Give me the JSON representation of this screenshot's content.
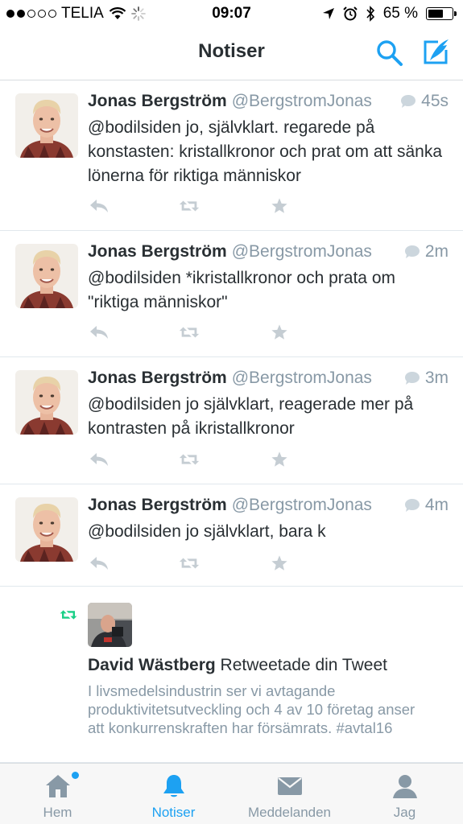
{
  "status_bar": {
    "carrier": "TELIA",
    "time": "09:07",
    "battery_percent": "65 %",
    "battery_level": 0.65,
    "signal_bars": 2
  },
  "header": {
    "title": "Notiser",
    "icons": [
      "search-icon",
      "compose-icon"
    ]
  },
  "tweets": [
    {
      "name": "Jonas Bergström",
      "handle": "@BergstromJonas",
      "time": "45s",
      "text": "@bodilsiden jo, självklart. regarede på konstasten: kristallkronor och prat om att sänka lönerna för riktiga människor"
    },
    {
      "name": "Jonas Bergström",
      "handle": "@BergstromJonas",
      "time": "2m",
      "text": "@bodilsiden *ikristallkronor och prata om \"riktiga människor\""
    },
    {
      "name": "Jonas Bergström",
      "handle": "@BergstromJonas",
      "time": "3m",
      "text": "@bodilsiden jo självklart, reagerade mer på kontrasten på ikristallkronor"
    },
    {
      "name": "Jonas Bergström",
      "handle": "@BergstromJonas",
      "time": "4m",
      "text": "@bodilsiden jo självklart, bara k"
    }
  ],
  "notification": {
    "name": "David Wästberg",
    "action": "Retweetade din Tweet",
    "quote": "I livsmedelsindustrin ser vi avtagande produktivitetsutveckling och 4 av 10 företag anser att konkurrenskraften har försämrats. #avtal16"
  },
  "tabs": [
    {
      "label": "Hem",
      "icon": "home-icon",
      "badge": true
    },
    {
      "label": "Notiser",
      "icon": "bell-icon",
      "active": true
    },
    {
      "label": "Meddelanden",
      "icon": "envelope-icon"
    },
    {
      "label": "Jag",
      "icon": "person-icon"
    }
  ],
  "colors": {
    "accent": "#1da1f2",
    "retweet": "#19cf86",
    "muted": "#8899a6",
    "text": "#292f33"
  }
}
